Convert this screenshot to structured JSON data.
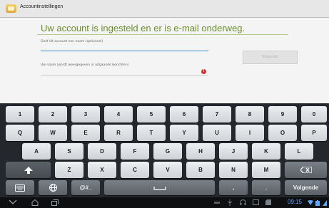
{
  "window": {
    "title": "Accountinstellingen"
  },
  "main": {
    "heading": "Uw account is ingesteld en er is e-mail onderweg.",
    "account_name_label": "Geef dit account een naam (optioneel)",
    "user_name_label": "Uw naam (wordt weergegeven in uitgaande berichten)",
    "next_button": "Volgende",
    "error_badge": "!"
  },
  "keyboard": {
    "row1": [
      "1",
      "2",
      "3",
      "4",
      "5",
      "6",
      "7",
      "8",
      "9",
      "0"
    ],
    "row2": [
      "Q",
      "W",
      "E",
      "R",
      "T",
      "Y",
      "U",
      "I",
      "O",
      "P"
    ],
    "row3": [
      "A",
      "S",
      "D",
      "F",
      "G",
      "H",
      "J",
      "K",
      "L"
    ],
    "row4": [
      "Z",
      "X",
      "C",
      "V",
      "B",
      "N",
      "M"
    ],
    "symbols_key": "@#_",
    "comma_key": ",",
    "period_key": ".",
    "enter_key": "Volgende"
  },
  "status": {
    "time": "09:15"
  }
}
